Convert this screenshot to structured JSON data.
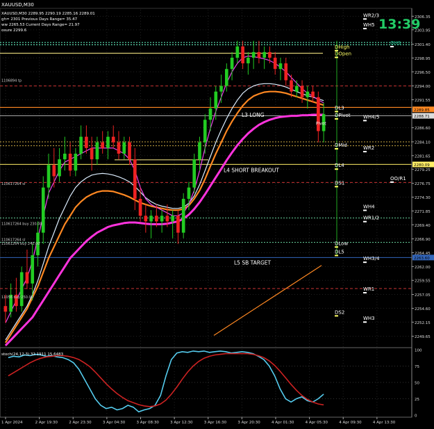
{
  "window_title": "XAUUSD,M30",
  "clock": "13:39",
  "info_lines": [
    "XAUUSD,M30  2289.95 2290.19 2285.16 2289.01",
    "gh= 2301     Previous Days Range= 35.47",
    "ww 2265.53    Current Days Range= 21.97",
    "osure 2299.6"
  ],
  "colors": {
    "background": "#000000",
    "bull": "#22cc22",
    "bear": "#ee2222",
    "clock": "#22cc66",
    "ma_fast": "#ee44ee",
    "ma_white": "#ddeeff",
    "ma_orange": "#ff8822",
    "ma_slow": "#ff33dd",
    "stoch_main": "#55ccee",
    "stoch_signal": "#cc2222",
    "label_white": "#ffffff",
    "l_line_white": "#ddddcc",
    "yellow_line": "#ffee88"
  },
  "chart_data": [
    {
      "type": "candlestick",
      "name_label": "XAUUSD,M30",
      "ylim": [
        2248,
        2307.5
      ],
      "y_ticks": [
        2306.35,
        2303.95,
        2301.4,
        2298.95,
        2296.5,
        2294.0,
        2291.55,
        2289.05,
        2286.6,
        2284.1,
        2281.65,
        2279.25,
        2276.75,
        2274.3,
        2271.85,
        2269.4,
        2266.9,
        2264.45,
        2262.0,
        2259.55,
        2257.05,
        2254.6,
        2252.15,
        2249.65
      ],
      "x_ticks": [
        "1 Apr 2024",
        "2 Apr 19:30",
        "2 Apr 23:30",
        "3 Apr 04:30",
        "3 Apr 08:30",
        "3 Apr 12:30",
        "3 Apr 16:30",
        "3 Apr 20:30",
        "4 Apr 01:30",
        "4 Apr 05:30",
        "4 Apr 09:30",
        "4 Apr 13:30"
      ],
      "price_badges": [
        {
          "value": "2289.85",
          "color": "#ff8822"
        },
        {
          "value": "2288.71",
          "color": "#dddddd"
        },
        {
          "value": "2280.09",
          "color": "#ffee66"
        },
        {
          "value": "2263.60",
          "color": "#3366bb"
        }
      ],
      "levels": [
        {
          "label": "WR2/3",
          "price": 2306.6,
          "color": "#ffffff"
        },
        {
          "label": "WH5",
          "price": 2304.9,
          "color": "#ffffff"
        },
        {
          "label": "OH3",
          "price": 2301.7,
          "color": "#22cc99"
        },
        {
          "label": "DHigh",
          "price": 2301.0,
          "color": "#ffff66"
        },
        {
          "label": "DOpen",
          "price": 2299.8,
          "color": "#ffff66"
        },
        {
          "label": "DL3",
          "price": 2290.2,
          "color": "#ffffff"
        },
        {
          "label": "DPivot",
          "price": 2288.9,
          "color": "#ffffff"
        },
        {
          "label": "WH4/5",
          "price": 2288.6,
          "color": "#ffffff"
        },
        {
          "label": "DMid",
          "price": 2283.6,
          "color": "#ffffff"
        },
        {
          "label": "WR2",
          "price": 2283.1,
          "color": "#ffffff"
        },
        {
          "label": "DL4",
          "price": 2280.0,
          "color": "#ffffff"
        },
        {
          "label": "DS1",
          "price": 2276.9,
          "color": "#ffffff"
        },
        {
          "label": "OO/R1",
          "price": 2277.7,
          "color": "#ffffff"
        },
        {
          "label": "WH4",
          "price": 2272.7,
          "color": "#ffffff"
        },
        {
          "label": "WR1/2",
          "price": 2270.7,
          "color": "#ffffff"
        },
        {
          "label": "DLow",
          "price": 2266.2,
          "color": "#ffffff"
        },
        {
          "label": "DL5",
          "price": 2264.7,
          "color": "#ffffff"
        },
        {
          "label": "WH3/4",
          "price": 2263.5,
          "color": "#ffffff"
        },
        {
          "label": "WR1",
          "price": 2258.1,
          "color": "#ffffff"
        },
        {
          "label": "DS2",
          "price": 2254.0,
          "color": "#ffffff"
        },
        {
          "label": "WH3",
          "price": 2252.9,
          "color": "#ffffff"
        }
      ],
      "annotations": [
        {
          "text": "L3 LONG",
          "price": 2288.9
        },
        {
          "text": "L4 SHORT BREAKOUT",
          "price": 2279.1
        },
        {
          "text": "L5 SB TARGET",
          "price": 2262.7
        },
        {
          "text": "Pivot",
          "price": 2287.5
        }
      ],
      "left_labels": [
        {
          "text": "1106894 tp",
          "price": 2295.0
        },
        {
          "text": "110617264 sl",
          "price": 2276.7
        },
        {
          "text": "110617264 buy 230.00",
          "price": 2269.6
        },
        {
          "text": "110617264 sl",
          "price": 2266.8
        },
        {
          "text": "11061264 buy 240.00",
          "price": 2266.1
        },
        {
          "text": "11056 buy 250.00",
          "price": 2256.6
        }
      ],
      "candles": [
        [
          2255,
          2257,
          2252,
          2254
        ],
        [
          2254,
          2259,
          2253,
          2257
        ],
        [
          2257,
          2260,
          2254,
          2255
        ],
        [
          2255,
          2262,
          2254,
          2261
        ],
        [
          2261,
          2265,
          2258,
          2259
        ],
        [
          2259,
          2266,
          2256,
          2264
        ],
        [
          2264,
          2270,
          2262,
          2268
        ],
        [
          2268,
          2278,
          2266,
          2276
        ],
        [
          2276,
          2282,
          2274,
          2280
        ],
        [
          2280,
          2283,
          2276,
          2278
        ],
        [
          2278,
          2283,
          2277,
          2281
        ],
        [
          2281,
          2285,
          2279,
          2282
        ],
        [
          2282,
          2284,
          2278,
          2279
        ],
        [
          2279,
          2283,
          2278,
          2282
        ],
        [
          2282,
          2287,
          2281,
          2285
        ],
        [
          2285,
          2287,
          2282,
          2283
        ],
        [
          2283,
          2285,
          2279,
          2281
        ],
        [
          2281,
          2285,
          2280,
          2284
        ],
        [
          2284,
          2286,
          2282,
          2283
        ],
        [
          2283,
          2286,
          2281,
          2285
        ],
        [
          2285,
          2287,
          2283,
          2284
        ],
        [
          2284,
          2286,
          2281,
          2282
        ],
        [
          2282,
          2285,
          2281,
          2284
        ],
        [
          2284,
          2285,
          2280,
          2281
        ],
        [
          2281,
          2283,
          2272,
          2274
        ],
        [
          2274,
          2276,
          2270,
          2271
        ],
        [
          2271,
          2273,
          2268,
          2270
        ],
        [
          2270,
          2272,
          2267,
          2271
        ],
        [
          2271,
          2273,
          2269,
          2270
        ],
        [
          2270,
          2272,
          2268,
          2271
        ],
        [
          2271,
          2273,
          2269,
          2270
        ],
        [
          2270,
          2272,
          2267,
          2271
        ],
        [
          2271,
          2272,
          2266,
          2268
        ],
        [
          2268,
          2275,
          2267,
          2274
        ],
        [
          2274,
          2277,
          2272,
          2276
        ],
        [
          2276,
          2282,
          2275,
          2281
        ],
        [
          2281,
          2285,
          2279,
          2284
        ],
        [
          2284,
          2289,
          2282,
          2288
        ],
        [
          2288,
          2292,
          2286,
          2290
        ],
        [
          2290,
          2294,
          2288,
          2293
        ],
        [
          2293,
          2296,
          2291,
          2294
        ],
        [
          2294,
          2298,
          2293,
          2297
        ],
        [
          2297,
          2300,
          2295,
          2299
        ],
        [
          2299,
          2302,
          2298,
          2301
        ],
        [
          2301,
          2302,
          2297,
          2298
        ],
        [
          2298,
          2300,
          2296,
          2299
        ],
        [
          2299,
          2302,
          2297,
          2300
        ],
        [
          2300,
          2302,
          2298,
          2299
        ],
        [
          2299,
          2301,
          2297,
          2300
        ],
        [
          2300,
          2301,
          2298,
          2299
        ],
        [
          2299,
          2300,
          2296,
          2297
        ],
        [
          2297,
          2299,
          2295,
          2298
        ],
        [
          2298,
          2299,
          2294,
          2295
        ],
        [
          2295,
          2296,
          2292,
          2293
        ],
        [
          2293,
          2295,
          2292,
          2294
        ],
        [
          2294,
          2295,
          2291,
          2292
        ],
        [
          2292,
          2294,
          2290,
          2293
        ],
        [
          2293,
          2294,
          2291,
          2292
        ],
        [
          2292,
          2293,
          2284,
          2286
        ],
        [
          2286,
          2291,
          2284,
          2289
        ]
      ],
      "ma_fast_values": [
        2252,
        2254,
        2256,
        2258,
        2260,
        2263,
        2267,
        2271,
        2275,
        2277,
        2279,
        2280.5,
        2281,
        2281.5,
        2282,
        2282.5,
        2283,
        2283,
        2283,
        2283,
        2283,
        2282.5,
        2282,
        2281,
        2279,
        2276,
        2274,
        2273,
        2272.5,
        2272,
        2271.5,
        2271,
        2271,
        2271.5,
        2273,
        2275.5,
        2279,
        2283,
        2286.5,
        2289.5,
        2292,
        2294.5,
        2296.5,
        2298,
        2299,
        2299.3,
        2299.2,
        2299,
        2298.8,
        2298.5,
        2298,
        2297.3,
        2296.5,
        2295.5,
        2294.5,
        2293.5,
        2292.7,
        2292.2,
        2291.5,
        2291
      ],
      "ma_white_values": [
        2249,
        2250.5,
        2252,
        2253.5,
        2255,
        2257,
        2259.5,
        2262.5,
        2265.5,
        2268,
        2270.5,
        2272.5,
        2274.5,
        2276,
        2277,
        2277.7,
        2278.2,
        2278.4,
        2278.5,
        2278.4,
        2278.2,
        2277.9,
        2277.5,
        2277,
        2276.2,
        2275.2,
        2274.2,
        2273.5,
        2273,
        2272.7,
        2272.5,
        2272.3,
        2272.3,
        2272.5,
        2273.2,
        2274.5,
        2276.5,
        2279,
        2281.5,
        2284,
        2286.2,
        2288.2,
        2290,
        2291.5,
        2292.7,
        2293.5,
        2294,
        2294.3,
        2294.4,
        2294.4,
        2294.3,
        2294.1,
        2293.8,
        2293.4,
        2293,
        2292.6,
        2292.3,
        2292,
        2291.7,
        2291.4
      ],
      "ma_orange_values": [
        2248.5,
        2250,
        2251.5,
        2253,
        2254.5,
        2256.5,
        2258.5,
        2261,
        2263.5,
        2265.5,
        2267.5,
        2269.5,
        2271,
        2272.5,
        2273.5,
        2274.3,
        2274.8,
        2275.2,
        2275.4,
        2275.4,
        2275.3,
        2275,
        2274.7,
        2274.3,
        2273.8,
        2273.3,
        2273,
        2272.7,
        2272.5,
        2272.3,
        2272.1,
        2272,
        2272,
        2272.2,
        2272.8,
        2274,
        2275.5,
        2277.5,
        2279.8,
        2282,
        2284,
        2286,
        2287.7,
        2289.2,
        2290.5,
        2291.5,
        2292.2,
        2292.6,
        2292.9,
        2293,
        2293,
        2292.9,
        2292.7,
        2292.4,
        2292.1,
        2291.8,
        2291.5,
        2291.2,
        2290.9,
        2290.6
      ],
      "ma_slow_values": [
        2248,
        2249,
        2250,
        2251,
        2252,
        2253,
        2254.5,
        2256,
        2257.5,
        2259,
        2260.5,
        2262,
        2263.5,
        2264.5,
        2265.5,
        2266.5,
        2267.3,
        2268,
        2268.5,
        2269,
        2269.3,
        2269.5,
        2269.7,
        2269.8,
        2269.8,
        2269.7,
        2269.6,
        2269.5,
        2269.5,
        2269.5,
        2269.6,
        2269.8,
        2270,
        2270.5,
        2271.2,
        2272.2,
        2273.4,
        2274.8,
        2276.3,
        2277.8,
        2279.3,
        2280.8,
        2282.2,
        2283.5,
        2284.6,
        2285.6,
        2286.4,
        2287.1,
        2287.6,
        2288,
        2288.3,
        2288.5,
        2288.6,
        2288.7,
        2288.7,
        2288.8,
        2288.8,
        2288.9,
        2288.9,
        2288.9
      ]
    },
    {
      "type": "line",
      "header": "stoch(24,12,3) 32.1911 15.6483",
      "ylim": [
        0,
        100
      ],
      "y_ticks": [
        100,
        75,
        50,
        25,
        0
      ],
      "series": [
        {
          "values": [
            88,
            90,
            89,
            92,
            91,
            93,
            92,
            90,
            91,
            89,
            88,
            85,
            80,
            70,
            55,
            40,
            25,
            15,
            10,
            12,
            8,
            10,
            15,
            12,
            5,
            8,
            10,
            15,
            30,
            60,
            85,
            95,
            97,
            96,
            98,
            97,
            98,
            96,
            97,
            98,
            97,
            95,
            96,
            97,
            96,
            94,
            90,
            85,
            75,
            60,
            40,
            25,
            20,
            25,
            28,
            22,
            20,
            25,
            32
          ]
        },
        {
          "values": [
            60,
            65,
            70,
            75,
            80,
            84,
            87,
            89,
            90,
            91,
            91,
            90,
            88,
            85,
            80,
            74,
            66,
            57,
            48,
            40,
            33,
            27,
            22,
            19,
            16,
            14,
            13,
            14,
            17,
            23,
            32,
            43,
            55,
            66,
            75,
            82,
            87,
            90,
            92,
            93,
            94,
            94,
            94,
            94,
            94,
            93,
            91,
            88,
            83,
            76,
            67,
            57,
            47,
            38,
            30,
            24,
            20,
            17,
            15.6
          ]
        }
      ]
    }
  ]
}
